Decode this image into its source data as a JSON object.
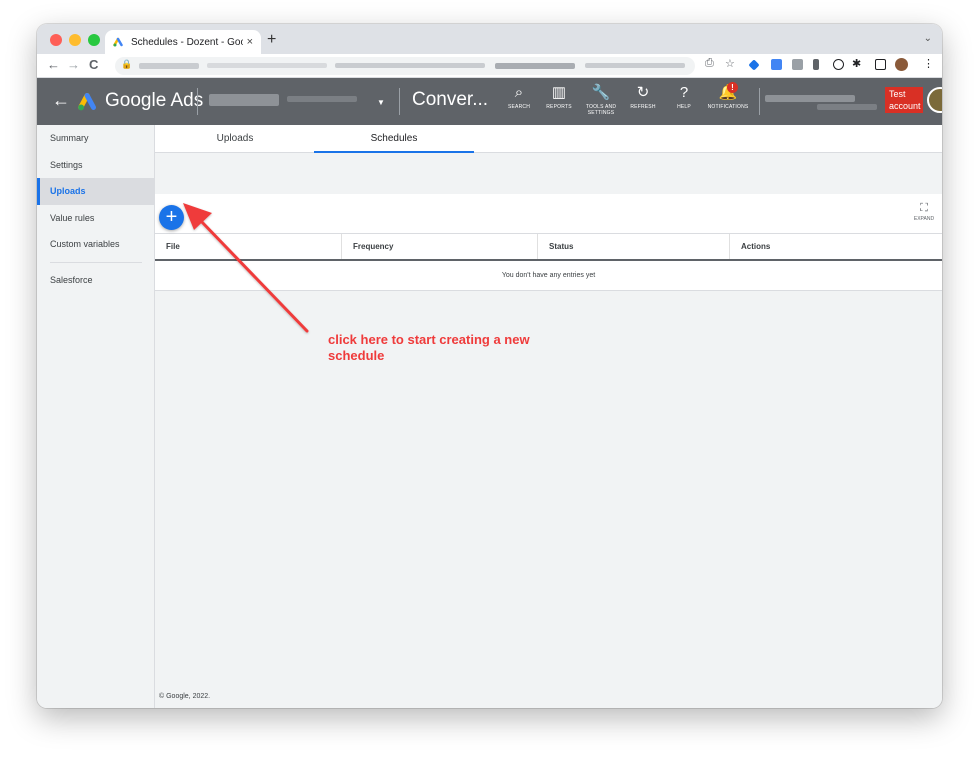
{
  "browser": {
    "tab_title": "Schedules - Dozent - Google Ads",
    "tab_close": "×",
    "new_tab": "+",
    "tab_menu": "⌄",
    "back": "←",
    "forward": "→",
    "reload": "C",
    "lock": "🔒"
  },
  "header": {
    "back": "←",
    "app_name": "Google Ads",
    "page_name": "Conver...",
    "caret": "▼",
    "tools": [
      {
        "icon": "⌕",
        "label": "SEARCH"
      },
      {
        "icon": "▥",
        "label": "REPORTS"
      },
      {
        "icon": "🔧",
        "label": "TOOLS AND SETTINGS"
      },
      {
        "icon": "↻",
        "label": "REFRESH"
      },
      {
        "icon": "?",
        "label": "HELP"
      },
      {
        "icon": "🔔",
        "label": "NOTIFICATIONS"
      }
    ],
    "notif_badge": "!",
    "test_account": "Test account"
  },
  "sidebar": {
    "items": [
      {
        "label": "Summary"
      },
      {
        "label": "Settings"
      },
      {
        "label": "Uploads"
      },
      {
        "label": "Value rules"
      },
      {
        "label": "Custom variables"
      },
      {
        "label": "Salesforce"
      }
    ],
    "active_index": 2
  },
  "main": {
    "tabs": [
      {
        "label": "Uploads"
      },
      {
        "label": "Schedules"
      }
    ],
    "selected_tab": 1,
    "add_button": "+",
    "expand_icon": "⛶",
    "expand_label": "EXPAND",
    "columns": [
      "File",
      "Frequency",
      "Status",
      "Actions"
    ],
    "empty_message": "You don't have any entries yet",
    "footer": "© Google, 2022."
  },
  "annotation": {
    "text": "click here to start creating a new schedule",
    "color": "#ef3b3b"
  },
  "colors": {
    "accent": "#1a73e8",
    "header_bg": "#5f6368",
    "badge_red": "#d93025"
  }
}
